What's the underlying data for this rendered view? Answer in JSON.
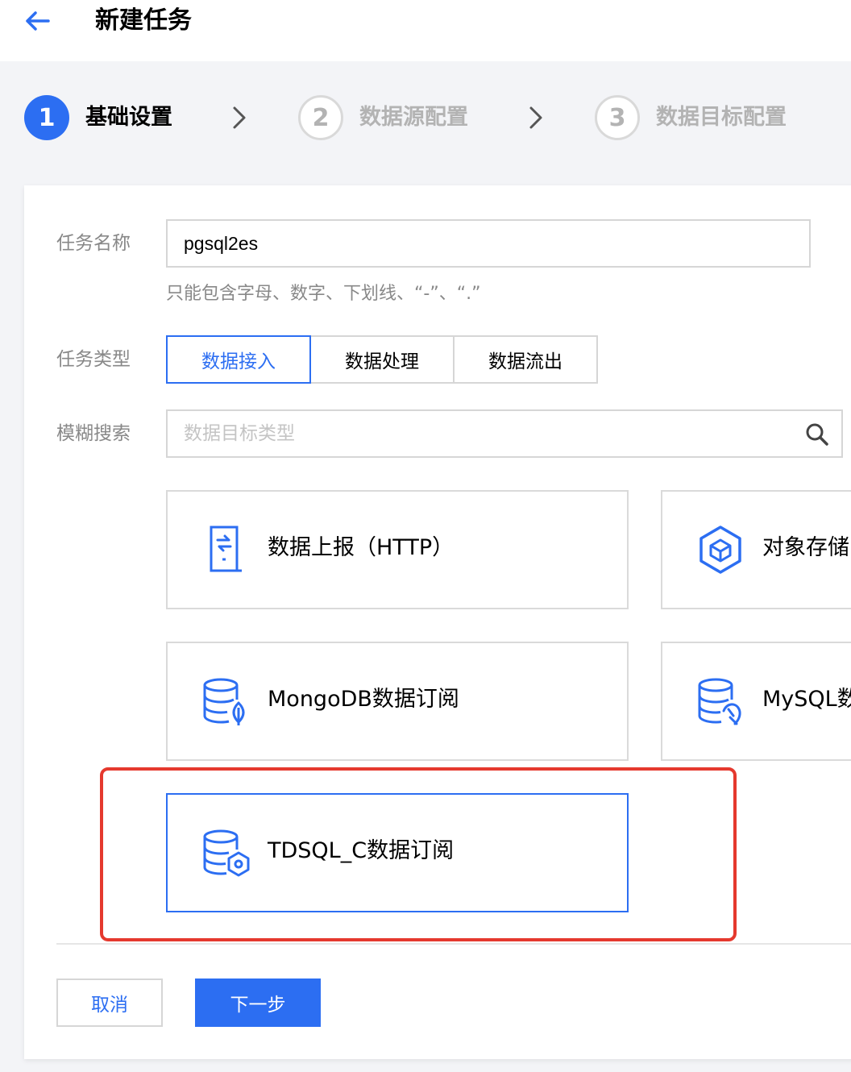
{
  "header": {
    "title": "新建任务",
    "back_icon": "arrow-left-icon"
  },
  "steps": [
    {
      "number": "1",
      "label": "基础设置",
      "state": "active"
    },
    {
      "number": "2",
      "label": "数据源配置",
      "state": "inactive"
    },
    {
      "number": "3",
      "label": "数据目标配置",
      "state": "inactive"
    }
  ],
  "form": {
    "task_name": {
      "label": "任务名称",
      "value": "pgsql2es",
      "hint": "只能包含字母、数字、下划线、“-”、“.”"
    },
    "task_type": {
      "label": "任务类型",
      "options": [
        "数据接入",
        "数据处理",
        "数据流出"
      ],
      "selected": "数据接入"
    },
    "search": {
      "label": "模糊搜索",
      "placeholder": "数据目标类型",
      "icon": "search-icon"
    }
  },
  "source_tiles": [
    {
      "label": "数据上报（HTTP）",
      "icon": "http-report-icon"
    },
    {
      "label": "对象存储",
      "icon": "object-storage-icon"
    },
    {
      "label": "MongoDB数据订阅",
      "icon": "mongodb-icon"
    },
    {
      "label": "MySQL数据订阅",
      "icon": "mysql-icon"
    },
    {
      "label": "TDSQL_C数据订阅",
      "icon": "tdsql-c-icon",
      "highlighted": true
    }
  ],
  "footer": {
    "cancel_label": "取消",
    "next_label": "下一步"
  },
  "colors": {
    "primary": "#2c6ef2",
    "annotation": "#e5392e",
    "background": "#f3f4f7"
  }
}
